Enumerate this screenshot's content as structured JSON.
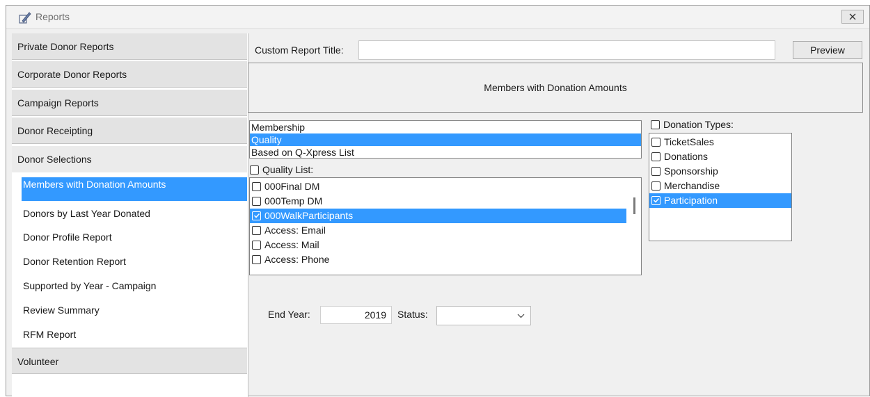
{
  "window": {
    "title": "Reports"
  },
  "sidebar": {
    "groups": [
      {
        "label": "Private Donor Reports"
      },
      {
        "label": "Corporate Donor Reports"
      },
      {
        "label": "Campaign Reports"
      },
      {
        "label": "Donor Receipting"
      },
      {
        "label": "Donor Selections"
      },
      {
        "label": "Volunteer"
      }
    ],
    "items": [
      {
        "label": "Members with Donation Amounts",
        "selected": true
      },
      {
        "label": "Donors by Last Year Donated"
      },
      {
        "label": "Donor Profile Report"
      },
      {
        "label": "Donor Retention Report"
      },
      {
        "label": "Supported by Year - Campaign"
      },
      {
        "label": "Review Summary"
      },
      {
        "label": "RFM Report"
      }
    ]
  },
  "report": {
    "custom_title_label": "Custom Report Title:",
    "custom_title_value": "",
    "preview_label": "Preview",
    "display_title": "Members with Donation Amounts"
  },
  "selection_type": {
    "options": [
      "Membership",
      "Quality",
      "Based on Q-Xpress List"
    ],
    "selected": "Quality"
  },
  "quality_list": {
    "label": "Quality List:",
    "checked": false,
    "items": [
      {
        "label": "000Final DM",
        "checked": false
      },
      {
        "label": "000Temp DM",
        "checked": false
      },
      {
        "label": "000WalkParticipants",
        "checked": true,
        "selected": true
      },
      {
        "label": "Access: Email",
        "checked": false
      },
      {
        "label": "Access: Mail",
        "checked": false
      },
      {
        "label": "Access: Phone",
        "checked": false
      }
    ]
  },
  "donation_types": {
    "label": "Donation Types:",
    "checked": false,
    "items": [
      {
        "label": "TicketSales",
        "checked": false
      },
      {
        "label": "Donations",
        "checked": false
      },
      {
        "label": "Sponsorship",
        "checked": false
      },
      {
        "label": "Merchandise",
        "checked": false
      },
      {
        "label": "Participation",
        "checked": true,
        "selected": true
      }
    ]
  },
  "filters": {
    "end_year_label": "End Year:",
    "end_year_value": "2019",
    "status_label": "Status:",
    "status_value": ""
  },
  "colors": {
    "selection": "#3399ff"
  }
}
